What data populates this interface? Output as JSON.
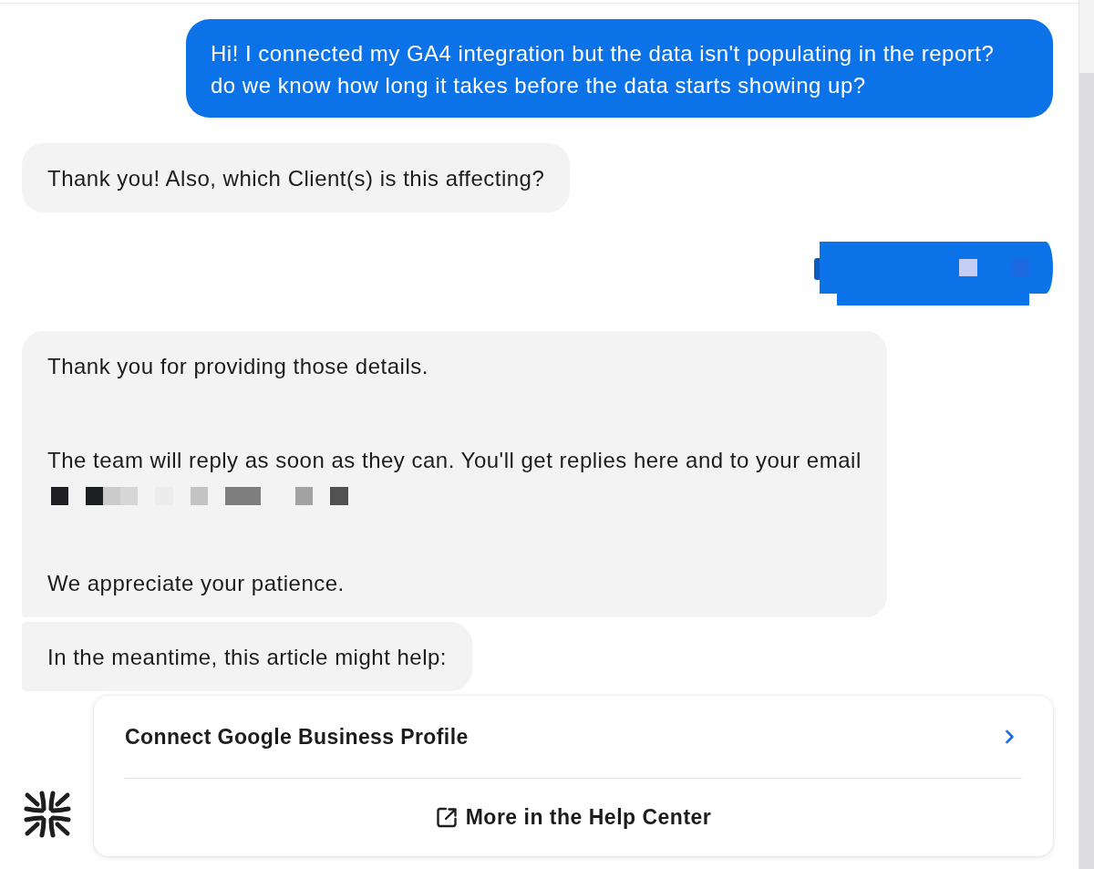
{
  "messages": [
    {
      "outgoing": true,
      "kind": "text",
      "paragraphs": [
        {
          "kind": "text",
          "text": "Hi! I connected my GA4 integration but the data isn't populating in the report? do we know how long it takes before the data starts showing up?"
        }
      ]
    },
    {
      "outgoing": false,
      "kind": "text",
      "paragraphs": [
        {
          "kind": "text",
          "text": "Thank you! Also, which Client(s) is this affecting?"
        }
      ]
    },
    {
      "outgoing": true,
      "kind": "redacted"
    },
    {
      "outgoing": false,
      "kind": "text",
      "paragraphs": [
        {
          "kind": "text",
          "text": "Thank you for providing those details."
        },
        {
          "kind": "text",
          "text": "The team will reply as soon as they can. You'll get replies here and to your email"
        },
        {
          "kind": "redacted"
        },
        {
          "kind": "text",
          "text": "We appreciate your patience."
        }
      ]
    },
    {
      "outgoing": false,
      "kind": "text",
      "paragraphs": [
        {
          "kind": "text",
          "text": "In the meantime, this article might help:"
        }
      ]
    }
  ],
  "article_card": {
    "title": "Connect Google Business Profile",
    "link": "More in the Help Center"
  }
}
